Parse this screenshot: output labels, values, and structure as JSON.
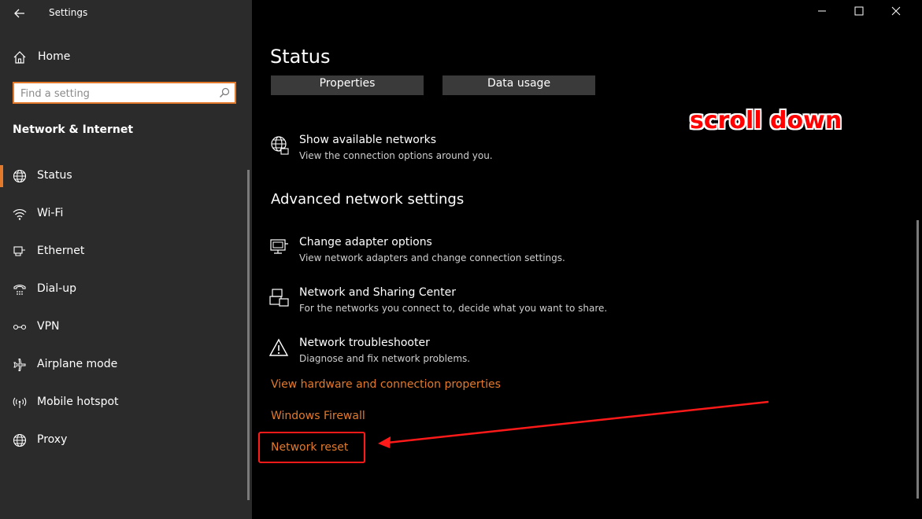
{
  "window": {
    "title": "Settings",
    "controls": {
      "minimize": "—",
      "maximize": "☐",
      "close": "✕"
    }
  },
  "sidebar": {
    "home_label": "Home",
    "search_placeholder": "Find a setting",
    "section_title": "Network & Internet",
    "items": [
      {
        "label": "Status",
        "icon": "globe-icon",
        "active": true
      },
      {
        "label": "Wi-Fi",
        "icon": "wifi-icon"
      },
      {
        "label": "Ethernet",
        "icon": "ethernet-icon"
      },
      {
        "label": "Dial-up",
        "icon": "dialup-icon"
      },
      {
        "label": "VPN",
        "icon": "vpn-icon"
      },
      {
        "label": "Airplane mode",
        "icon": "airplane-icon"
      },
      {
        "label": "Mobile hotspot",
        "icon": "hotspot-icon"
      },
      {
        "label": "Proxy",
        "icon": "globe-icon"
      }
    ]
  },
  "main": {
    "page_title": "Status",
    "buttons": {
      "properties": "Properties",
      "data_usage": "Data usage"
    },
    "show_networks": {
      "title": "Show available networks",
      "subtitle": "View the connection options around you."
    },
    "advanced_heading": "Advanced network settings",
    "advanced_items": [
      {
        "title": "Change adapter options",
        "subtitle": "View network adapters and change connection settings.",
        "icon": "adapter-icon"
      },
      {
        "title": "Network and Sharing Center",
        "subtitle": "For the networks you connect to, decide what you want to share.",
        "icon": "sharing-center-icon"
      },
      {
        "title": "Network troubleshooter",
        "subtitle": "Diagnose and fix network problems.",
        "icon": "warning-icon"
      }
    ],
    "links": {
      "hardware": "View hardware and connection properties",
      "firewall": "Windows Firewall",
      "reset": "Network reset"
    }
  },
  "annotation": {
    "text": "scroll down"
  },
  "colors": {
    "accent": "#e37a2b",
    "annotation": "#ff0000",
    "sidebar_bg": "#2b2b2b",
    "button_bg": "#3a3a3a"
  }
}
